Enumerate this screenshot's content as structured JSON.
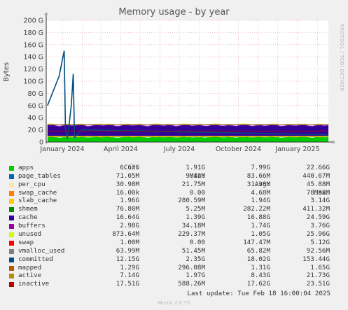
{
  "title": "Memory usage - by year",
  "side_text": "RRDTOOL / TOBI OETIKER",
  "footer": "Last update: Tue Feb 18 16:00:04 2025",
  "version": "Munin 2.0.75",
  "legend_headers": {
    "cur": "Cur:",
    "min": "Min:",
    "avg": "Avg:",
    "max": "Max:"
  },
  "legend": [
    {
      "name": "apps",
      "color": "#00cc00",
      "cur": "6.63G",
      "min": "1.91G",
      "avg": "7.99G",
      "max": "22.66G"
    },
    {
      "name": "page_tables",
      "color": "#0066b3",
      "cur": "71.05M",
      "min": "9.42M",
      "avg": "83.66M",
      "max": "440.67M"
    },
    {
      "name": "per_cpu",
      "color": "#ffe0b0",
      "cur": "30.98M",
      "min": "21.75M",
      "avg": "31.38M",
      "max": "45.88M"
    },
    {
      "name": "swap_cache",
      "color": "#ff8000",
      "cur": "16.00k",
      "min": "0.00",
      "avg": "4.68M",
      "max": "78.88M"
    },
    {
      "name": "slab_cache",
      "color": "#ffcc00",
      "cur": "1.96G",
      "min": "280.59M",
      "avg": "1.94G",
      "max": "3.14G"
    },
    {
      "name": "shmem",
      "color": "#008f00",
      "cur": "76.80M",
      "min": "5.25M",
      "avg": "282.22M",
      "max": "411.32M"
    },
    {
      "name": "cache",
      "color": "#330099",
      "cur": "16.64G",
      "min": "1.39G",
      "avg": "16.88G",
      "max": "24.59G"
    },
    {
      "name": "buffers",
      "color": "#990099",
      "cur": "2.98G",
      "min": "34.18M",
      "avg": "1.74G",
      "max": "3.76G"
    },
    {
      "name": "unused",
      "color": "#ccff00",
      "cur": "873.64M",
      "min": "229.37M",
      "avg": "1.05G",
      "max": "25.96G"
    },
    {
      "name": "swap",
      "color": "#ff0000",
      "cur": "1.00M",
      "min": "0.00",
      "avg": "147.47M",
      "max": "5.12G"
    },
    {
      "name": "vmalloc_used",
      "color": "#808080",
      "cur": "63.99M",
      "min": "51.45M",
      "avg": "65.82M",
      "max": "92.56M"
    },
    {
      "name": "committed",
      "color": "#004d80",
      "cur": "12.15G",
      "min": "2.35G",
      "avg": "18.02G",
      "max": "153.44G"
    },
    {
      "name": "mapped",
      "color": "#b35a00",
      "cur": "1.29G",
      "min": "296.08M",
      "avg": "1.31G",
      "max": "1.65G"
    },
    {
      "name": "active",
      "color": "#b38f00",
      "cur": "7.14G",
      "min": "1.97G",
      "avg": "8.43G",
      "max": "21.73G"
    },
    {
      "name": "inactive",
      "color": "#b30000",
      "cur": "17.51G",
      "min": "588.26M",
      "avg": "17.62G",
      "max": "23.51G"
    }
  ],
  "chart_data": {
    "type": "area",
    "title": "Memory usage - by year",
    "ylabel": "Bytes",
    "ylim": [
      0,
      200
    ],
    "y_unit": "G",
    "y_ticks": [
      "0",
      "20 G",
      "40 G",
      "60 G",
      "80 G",
      "100 G",
      "120 G",
      "140 G",
      "160 G",
      "180 G",
      "200 G"
    ],
    "x_ticks": [
      "January 2024",
      "April 2024",
      "July 2024",
      "October 2024",
      "January 2025"
    ],
    "x_range": [
      "2023-12-07",
      "2025-02-18"
    ],
    "grid": true,
    "stacked_components_approx_G": {
      "apps": 8,
      "page_tables": 0.08,
      "per_cpu": 0.03,
      "swap_cache": 0.005,
      "slab_cache": 1.9,
      "shmem": 0.28,
      "cache": 16.9,
      "buffers": 1.7,
      "unused": 1.0
    },
    "series": [
      {
        "name": "committed",
        "x": [
          "2023-12-09",
          "2023-12-27",
          "2024-01-04",
          "2024-01-06",
          "2024-01-09",
          "2024-01-15",
          "2024-01-18",
          "2024-01-20",
          "2024-02-01",
          "2025-02-18"
        ],
        "y": [
          60,
          108,
          150,
          20,
          5,
          60,
          112,
          8,
          20,
          12
        ]
      },
      {
        "name": "inactive",
        "x": [
          "2023-12-07",
          "2024-06-01",
          "2025-02-18"
        ],
        "y": [
          17,
          18,
          17.5
        ]
      },
      {
        "name": "active",
        "x": [
          "2023-12-07",
          "2024-06-01",
          "2025-02-18"
        ],
        "y": [
          8,
          8.5,
          7.1
        ]
      }
    ]
  }
}
